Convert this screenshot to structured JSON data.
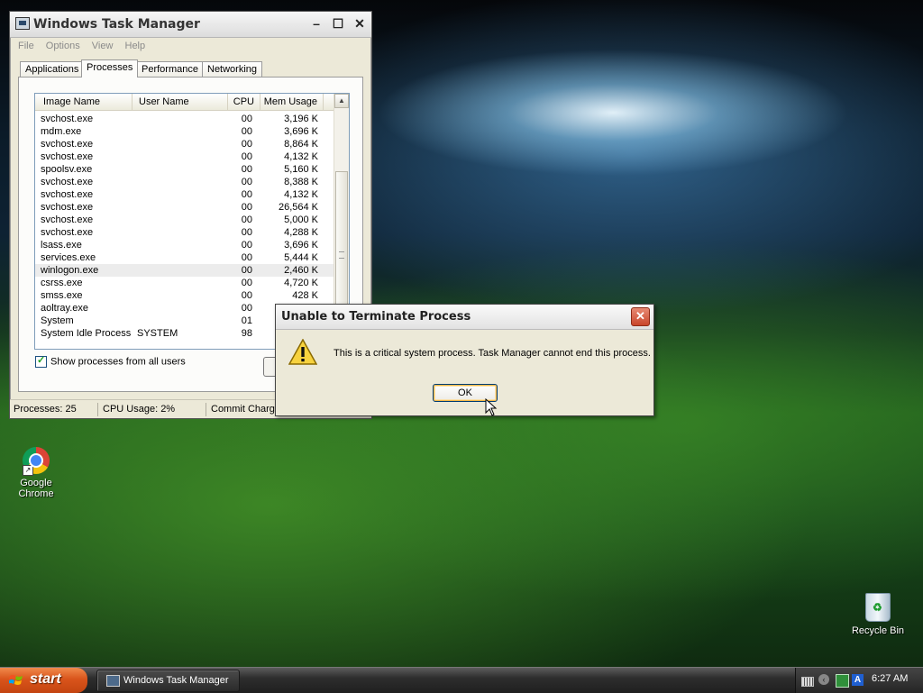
{
  "task_manager": {
    "title": "Windows Task Manager",
    "menu": [
      "File",
      "Options",
      "View",
      "Help"
    ],
    "tabs": [
      "Applications",
      "Processes",
      "Performance",
      "Networking"
    ],
    "active_tab": "Processes",
    "columns": [
      "Image Name",
      "User Name",
      "CPU",
      "Mem Usage"
    ],
    "processes": [
      {
        "name": "svchost.exe",
        "user": "",
        "cpu": "00",
        "mem": "3,196 K"
      },
      {
        "name": "mdm.exe",
        "user": "",
        "cpu": "00",
        "mem": "3,696 K"
      },
      {
        "name": "svchost.exe",
        "user": "",
        "cpu": "00",
        "mem": "8,864 K"
      },
      {
        "name": "svchost.exe",
        "user": "",
        "cpu": "00",
        "mem": "4,132 K"
      },
      {
        "name": "spoolsv.exe",
        "user": "",
        "cpu": "00",
        "mem": "5,160 K"
      },
      {
        "name": "svchost.exe",
        "user": "",
        "cpu": "00",
        "mem": "8,388 K"
      },
      {
        "name": "svchost.exe",
        "user": "",
        "cpu": "00",
        "mem": "4,132 K"
      },
      {
        "name": "svchost.exe",
        "user": "",
        "cpu": "00",
        "mem": "26,564 K"
      },
      {
        "name": "svchost.exe",
        "user": "",
        "cpu": "00",
        "mem": "5,000 K"
      },
      {
        "name": "svchost.exe",
        "user": "",
        "cpu": "00",
        "mem": "4,288 K"
      },
      {
        "name": "lsass.exe",
        "user": "",
        "cpu": "00",
        "mem": "3,696 K"
      },
      {
        "name": "services.exe",
        "user": "",
        "cpu": "00",
        "mem": "5,444 K"
      },
      {
        "name": "winlogon.exe",
        "user": "",
        "cpu": "00",
        "mem": "2,460 K",
        "selected": true
      },
      {
        "name": "csrss.exe",
        "user": "",
        "cpu": "00",
        "mem": "4,720 K"
      },
      {
        "name": "smss.exe",
        "user": "",
        "cpu": "00",
        "mem": "428 K"
      },
      {
        "name": "aoltray.exe",
        "user": "",
        "cpu": "00",
        "mem": ""
      },
      {
        "name": "System",
        "user": "",
        "cpu": "01",
        "mem": ""
      },
      {
        "name": "System Idle Process",
        "user": "SYSTEM",
        "cpu": "98",
        "mem": ""
      }
    ],
    "show_all_users_label": "Show processes from all users",
    "show_all_users_checked": true,
    "status": {
      "processes": "Processes: 25",
      "cpu_usage": "CPU Usage: 2%",
      "commit_charge": "Commit Charge"
    }
  },
  "dialog": {
    "title": "Unable to Terminate Process",
    "message": "This is a critical system process.  Task Manager cannot end this process.",
    "ok_label": "OK",
    "icon": "warning-icon"
  },
  "desktop": {
    "icons": [
      {
        "label": "Google Chrome",
        "icon": "chrome-icon"
      },
      {
        "label": "Recycle Bin",
        "icon": "recycle-bin-icon"
      }
    ]
  },
  "taskbar": {
    "start_label": "start",
    "task_button_label": "Windows Task Manager",
    "clock": "6:27 AM"
  },
  "colors": {
    "start_orange": "#d9541b",
    "dialog_close_red": "#c9452a",
    "selection_gray": "#ececec"
  }
}
